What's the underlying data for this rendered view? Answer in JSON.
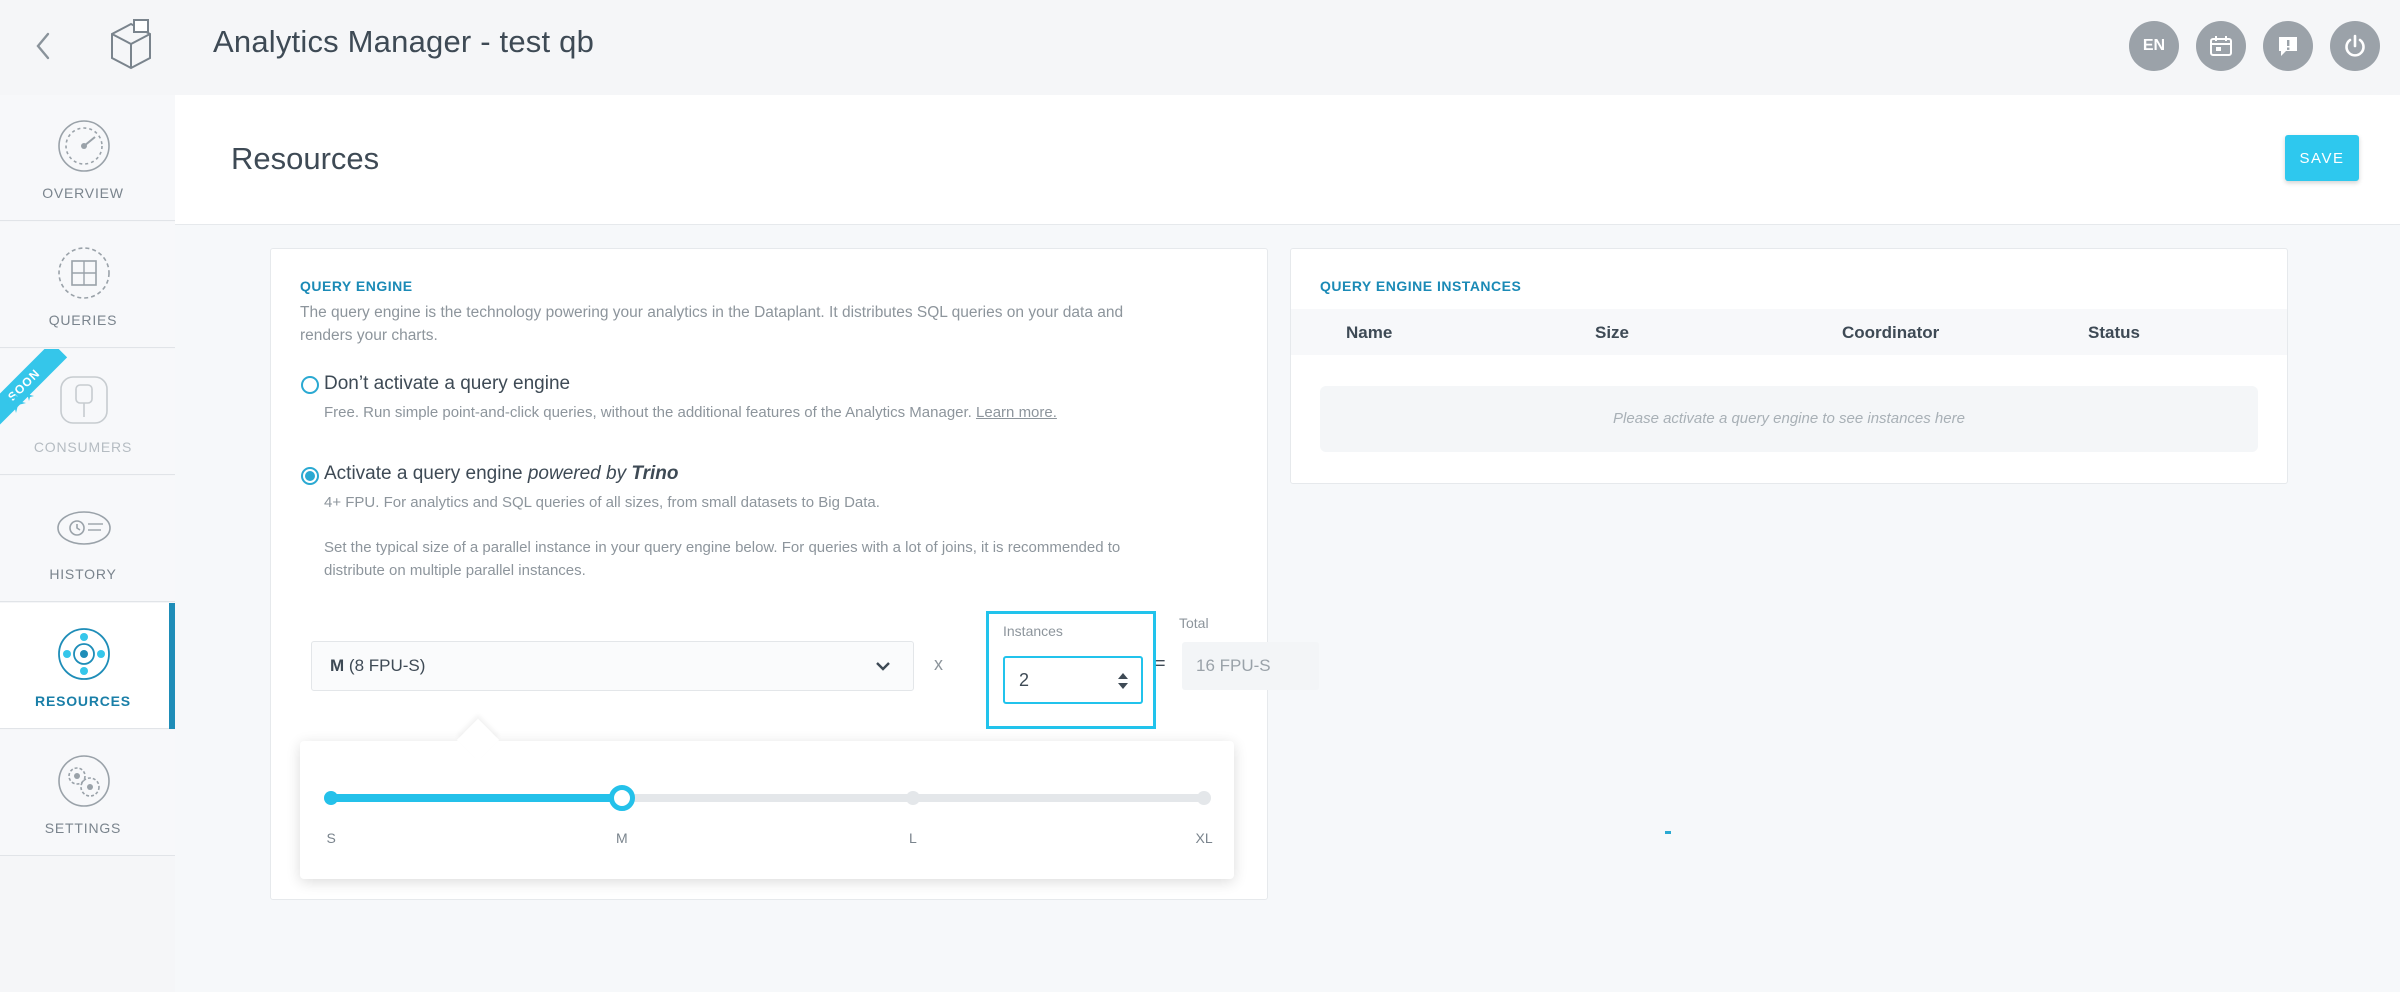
{
  "header": {
    "app_title": "Analytics Manager - test qb",
    "buttons": {
      "language": "EN"
    }
  },
  "sidebar": {
    "items": [
      {
        "label": "OVERVIEW",
        "icon": "dashboard-gauge-icon"
      },
      {
        "label": "QUERIES",
        "icon": "queries-grid-icon"
      },
      {
        "label": "CONSUMERS",
        "icon": "plug-icon",
        "badge": "SOON"
      },
      {
        "label": "HISTORY",
        "icon": "history-clock-icon"
      },
      {
        "label": "RESOURCES",
        "icon": "resources-cog-icon",
        "active": true
      },
      {
        "label": "SETTINGS",
        "icon": "settings-gear-icon"
      }
    ]
  },
  "page": {
    "title": "Resources",
    "save_label": "SAVE"
  },
  "query_engine": {
    "title": "QUERY ENGINE",
    "description_line1": "The query engine is the technology powering your analytics in the Dataplant. It distributes SQL queries on your data and",
    "description_line2": "renders your charts.",
    "option_off": {
      "title": "Don’t activate a query engine",
      "description": "Free. Run simple point-and-click queries, without the additional features of the Analytics Manager.",
      "link": "Learn more."
    },
    "option_on": {
      "title_prefix": "Activate a query engine",
      "title_powered": "powered by",
      "title_brand": "Trino",
      "description": "4+ FPU. For analytics and SQL queries of all sizes, from small datasets to Big Data.",
      "hint_line1": "Set the typical size of a parallel instance in your query engine below. For queries with a lot of joins, it is recommended to",
      "hint_line2": "distribute on multiple parallel instances.",
      "selected": true
    },
    "size_select": {
      "size": "M",
      "detail": "(8 FPU-S)"
    },
    "multiply_sign": "x",
    "instances": {
      "label": "Instances",
      "value": "2"
    },
    "equals_sign": "=",
    "total": {
      "label": "Total",
      "value": "16 FPU-S"
    },
    "slider": {
      "stops": [
        "S",
        "M",
        "L",
        "XL"
      ],
      "selected_index": 1
    }
  },
  "instances_panel": {
    "title": "QUERY ENGINE INSTANCES",
    "columns": [
      "Name",
      "Size",
      "Coordinator",
      "Status"
    ],
    "empty_message": "Please activate a query engine to see instances here"
  },
  "colors": {
    "accent": "#2ec8ee",
    "primary_text": "#3e4a55",
    "section_title": "#1a8ab6",
    "active_nav": "#1e8db8"
  }
}
